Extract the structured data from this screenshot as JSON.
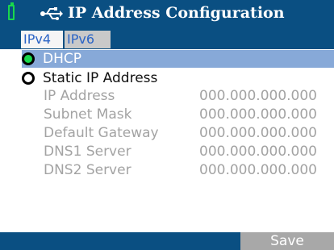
{
  "window": {
    "title": "IP Address Configuration",
    "battery_icon": "battery-icon",
    "usb_icon": "usb-icon"
  },
  "tabs": [
    {
      "label": "IPv4",
      "active": true
    },
    {
      "label": "IPv6",
      "active": false
    }
  ],
  "mode": {
    "options": [
      {
        "label": "DHCP",
        "selected": true
      },
      {
        "label": "Static IP Address",
        "selected": false
      }
    ]
  },
  "fields": [
    {
      "label": "IP Address",
      "value": "000.000.000.000"
    },
    {
      "label": "Subnet Mask",
      "value": "000.000.000.000"
    },
    {
      "label": "Default Gateway",
      "value": "000.000.000.000"
    },
    {
      "label": "DNS1 Server",
      "value": "000.000.000.000"
    },
    {
      "label": "DNS2 Server",
      "value": "000.000.000.000"
    }
  ],
  "footer": {
    "save_label": "Save"
  },
  "colors": {
    "titlebar": "#0a4f82",
    "selection": "#87a9d8",
    "radio_on": "#19d84c",
    "disabled_text": "#a3a3a3"
  }
}
